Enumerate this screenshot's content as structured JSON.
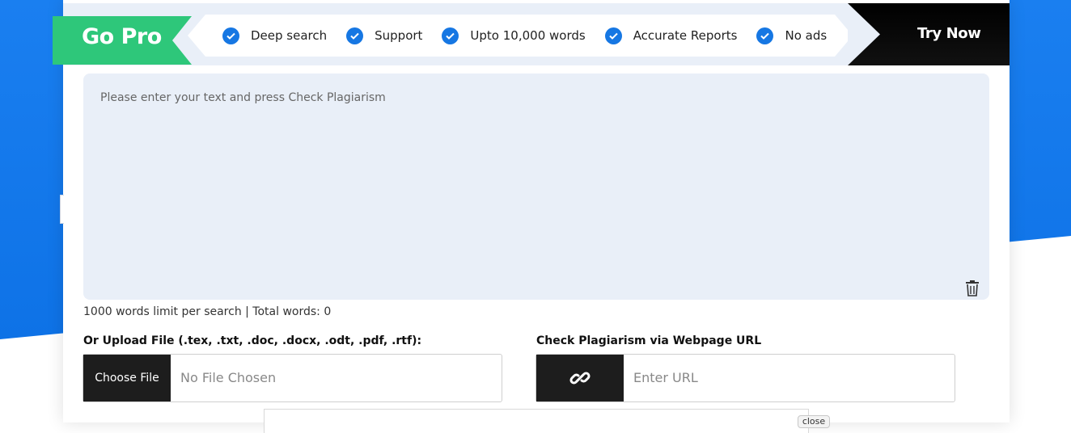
{
  "pro_banner": {
    "title": "Go Pro",
    "features": [
      {
        "label": "Deep search"
      },
      {
        "label": "Support"
      },
      {
        "label": "Upto 10,000 words"
      },
      {
        "label": "Accurate Reports"
      },
      {
        "label": "No ads"
      }
    ],
    "cta_label": "Try Now",
    "colors": {
      "badge": "#2ec77a",
      "check": "#1677e3",
      "cta": "#000000"
    }
  },
  "editor": {
    "placeholder": "Please enter your text and press Check Plagiarism",
    "word_info": "1000 words limit per search | Total words: 0"
  },
  "upload": {
    "label": "Or Upload File (.tex, .txt, .doc, .docx, .odt, .pdf, .rtf):",
    "button_label": "Choose File",
    "status": "No File Chosen"
  },
  "url_check": {
    "label": "Check Plagiarism via Webpage URL",
    "placeholder": "Enter URL",
    "icon": "link-icon"
  },
  "ad": {
    "close_label": "close"
  },
  "icons": {
    "trash": "trash-icon",
    "check": "check-circle-icon"
  }
}
